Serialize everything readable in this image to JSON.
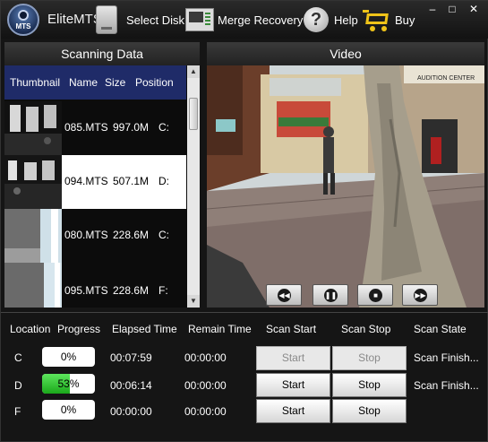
{
  "app": {
    "title": "EliteMTS",
    "logo_text": "MTS"
  },
  "toolbar": {
    "select_disk": "Select Disk",
    "merge_recovery": "Merge Recovery",
    "help": "Help",
    "buy": "Buy"
  },
  "window_controls": {
    "minimize": "–",
    "maximize": "□",
    "close": "✕"
  },
  "scanning_panel": {
    "title": "Scanning  Data",
    "columns": [
      "Thumbnail",
      "Name",
      "Size",
      "Position"
    ],
    "rows": [
      {
        "name": "085.MTS",
        "size": "997.0M",
        "position": "C:",
        "selected": false
      },
      {
        "name": "094.MTS",
        "size": "507.1M",
        "position": "D:",
        "selected": true
      },
      {
        "name": "080.MTS",
        "size": "228.6M",
        "position": "C:",
        "selected": false
      },
      {
        "name": "095.MTS",
        "size": "228.6M",
        "position": "F:",
        "selected": false
      }
    ]
  },
  "video_panel": {
    "title": "Video",
    "controls": [
      "rewind",
      "pause",
      "stop",
      "fast-forward"
    ],
    "sign_text": "AUDITION CENTER"
  },
  "scan_table": {
    "headers": {
      "location": "Location",
      "progress": "Progress",
      "elapsed": "Elapsed Time",
      "remain": "Remain  Time",
      "scan_start": "Scan Start",
      "scan_stop": "Scan Stop",
      "scan_state": "Scan State"
    },
    "rows": [
      {
        "location": "C",
        "progress": "0%",
        "progress_value": 0.0,
        "elapsed": "00:07:59",
        "remain": "00:00:00",
        "start": "Start",
        "stop": "Stop",
        "start_enabled": false,
        "stop_enabled": false,
        "state": "Scan Finish..."
      },
      {
        "location": "D",
        "progress": "53%",
        "progress_value": 0.53,
        "elapsed": "00:06:14",
        "remain": "00:00:00",
        "start": "Start",
        "stop": "Stop",
        "start_enabled": true,
        "stop_enabled": true,
        "state": "Scan Finish..."
      },
      {
        "location": "F",
        "progress": "0%",
        "progress_value": 0.0,
        "elapsed": "00:00:00",
        "remain": "00:00:00",
        "start": "Start",
        "stop": "Stop",
        "start_enabled": true,
        "stop_enabled": true,
        "state": ""
      }
    ]
  },
  "colors": {
    "accent_header": "#1f2b68",
    "progress_fill": "#2fc42f",
    "cart": "#f0c419"
  }
}
